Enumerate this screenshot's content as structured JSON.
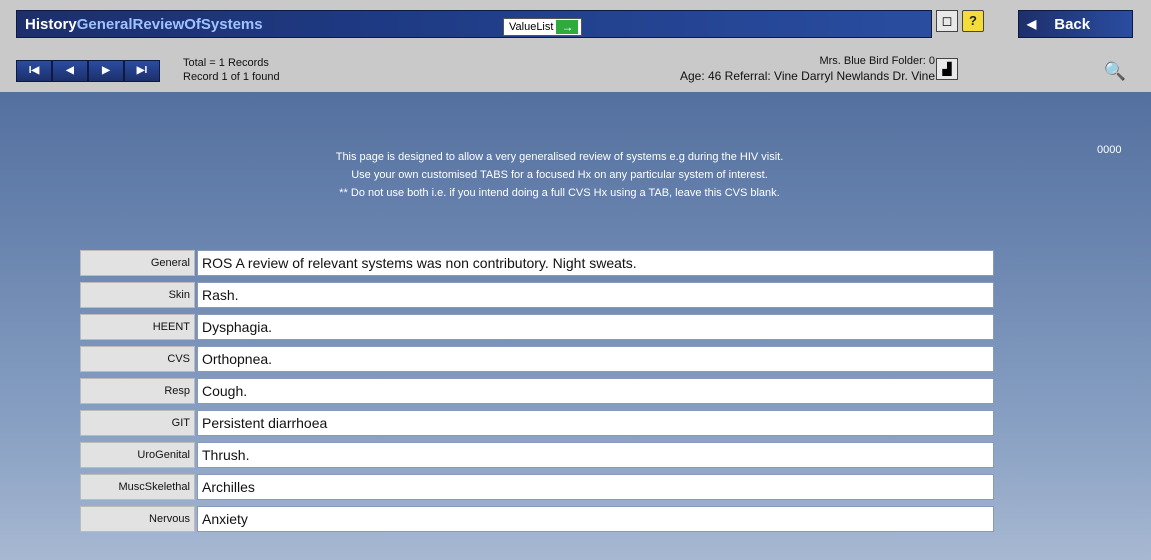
{
  "window": {
    "title_main": "History",
    "title_sub": "GeneralReviewOfSystems",
    "value_list_label": "ValueList",
    "value_list_arrow": "→",
    "window_button": "◻",
    "help_button": "?",
    "back_label": "Back",
    "back_arrow": "◀"
  },
  "nav": {
    "first": "I◀",
    "prev": "◀",
    "next": "▶",
    "last": "▶I",
    "total_line": "Total = 1 Records",
    "record_line": "Record 1 of 1 found",
    "patient_line1": "Mrs. Blue Bird  Folder: 0",
    "patient_line2": "Age: 46 Referral: Vine  Darryl  Newlands  Dr. Vine",
    "chart_button": "▟",
    "zoom_button": "🔍"
  },
  "content": {
    "info_lines": [
      "This page is designed to allow a very generalised review of systems e.g during the HIV visit.",
      "Use your own customised TABS for a focused Hx on any particular system of interest.",
      "** Do not use both i.e. if you intend doing a full CVS Hx using a TAB, leave this CVS blank."
    ],
    "code": "0000",
    "rows": [
      {
        "label": "General",
        "value": "ROS A review of relevant systems was non contributory. Night sweats."
      },
      {
        "label": "Skin",
        "value": "Rash."
      },
      {
        "label": "HEENT",
        "value": "Dysphagia."
      },
      {
        "label": "CVS",
        "value": "Orthopnea."
      },
      {
        "label": "Resp",
        "value": "Cough."
      },
      {
        "label": "GIT",
        "value": "Persistent diarrhoea"
      },
      {
        "label": "UroGenital",
        "value": "Thrush."
      },
      {
        "label": "MuscSkelethal",
        "value": "Archilles"
      },
      {
        "label": "Nervous",
        "value": "Anxiety"
      }
    ]
  },
  "colors": {
    "title_bar": "#1e3a84",
    "background_top": "#54709e",
    "background_bottom": "#a7b8d2",
    "accent_green": "#2eab3c",
    "help_yellow": "#f6dc3a"
  }
}
